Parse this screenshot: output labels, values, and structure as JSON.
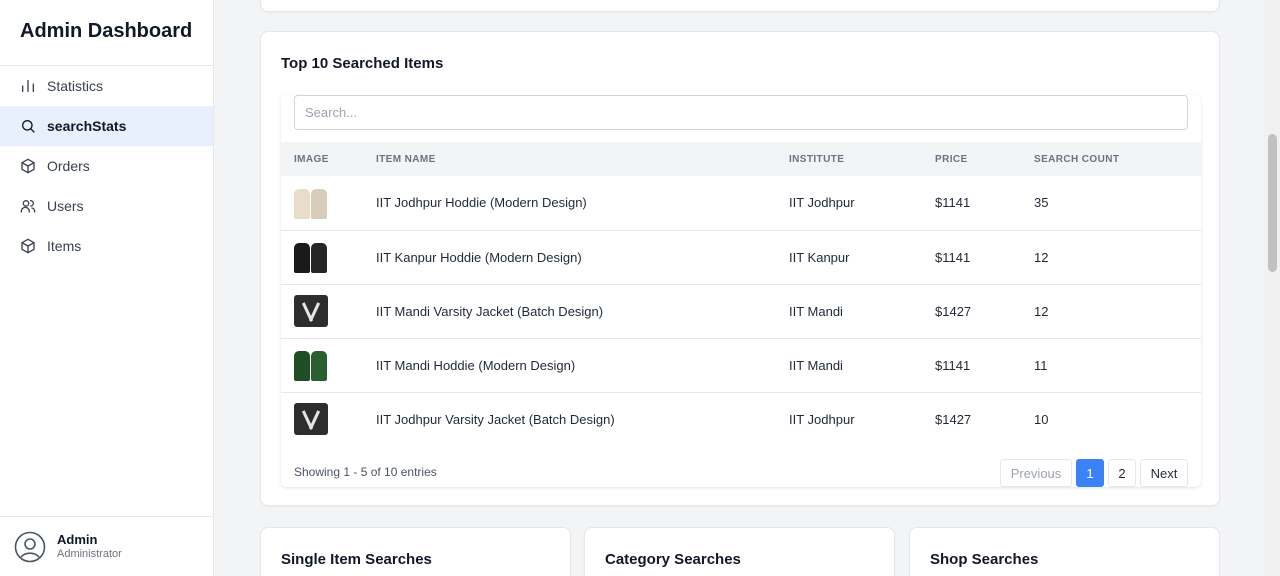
{
  "sidebar": {
    "title": "Admin Dashboard",
    "items": [
      {
        "label": "Statistics",
        "icon": "bar-chart-icon"
      },
      {
        "label": "searchStats",
        "icon": "search-icon"
      },
      {
        "label": "Orders",
        "icon": "package-icon"
      },
      {
        "label": "Users",
        "icon": "users-icon"
      },
      {
        "label": "Items",
        "icon": "package-icon"
      }
    ],
    "active_item": "searchStats",
    "user": {
      "name": "Admin",
      "role": "Administrator"
    }
  },
  "main": {
    "top_searched": {
      "title": "Top 10 Searched Items",
      "search": {
        "placeholder": "Search...",
        "value": ""
      },
      "columns": [
        "IMAGE",
        "ITEM NAME",
        "INSTITUTE",
        "PRICE",
        "SEARCH COUNT"
      ],
      "rows": [
        {
          "name": "IIT Jodhpur Hoddie (Modern Design)",
          "institute": "IIT Jodhpur",
          "price": "$1141",
          "count": "35",
          "thumb": "hoodie-cream"
        },
        {
          "name": "IIT Kanpur Hoddie (Modern Design)",
          "institute": "IIT Kanpur",
          "price": "$1141",
          "count": "12",
          "thumb": "hoodie-black"
        },
        {
          "name": "IIT Mandi Varsity Jacket (Batch Design)",
          "institute": "IIT Mandi",
          "price": "$1427",
          "count": "12",
          "thumb": "varsity-jacket"
        },
        {
          "name": "IIT Mandi Hoddie (Modern Design)",
          "institute": "IIT Mandi",
          "price": "$1141",
          "count": "11",
          "thumb": "hoodie-green"
        },
        {
          "name": "IIT Jodhpur Varsity Jacket (Batch Design)",
          "institute": "IIT Jodhpur",
          "price": "$1427",
          "count": "10",
          "thumb": "varsity-jacket"
        }
      ],
      "footer": "Showing 1 - 5 of 10 entries",
      "pagination": {
        "previous": "Previous",
        "pages": [
          "1",
          "2"
        ],
        "current": "1",
        "next": "Next"
      }
    },
    "cards": [
      {
        "title": "Single Item Searches"
      },
      {
        "title": "Category Searches"
      },
      {
        "title": "Shop Searches"
      }
    ]
  },
  "colors": {
    "accent": "#3b82f6",
    "active_nav_bg": "#e8f0fe"
  }
}
